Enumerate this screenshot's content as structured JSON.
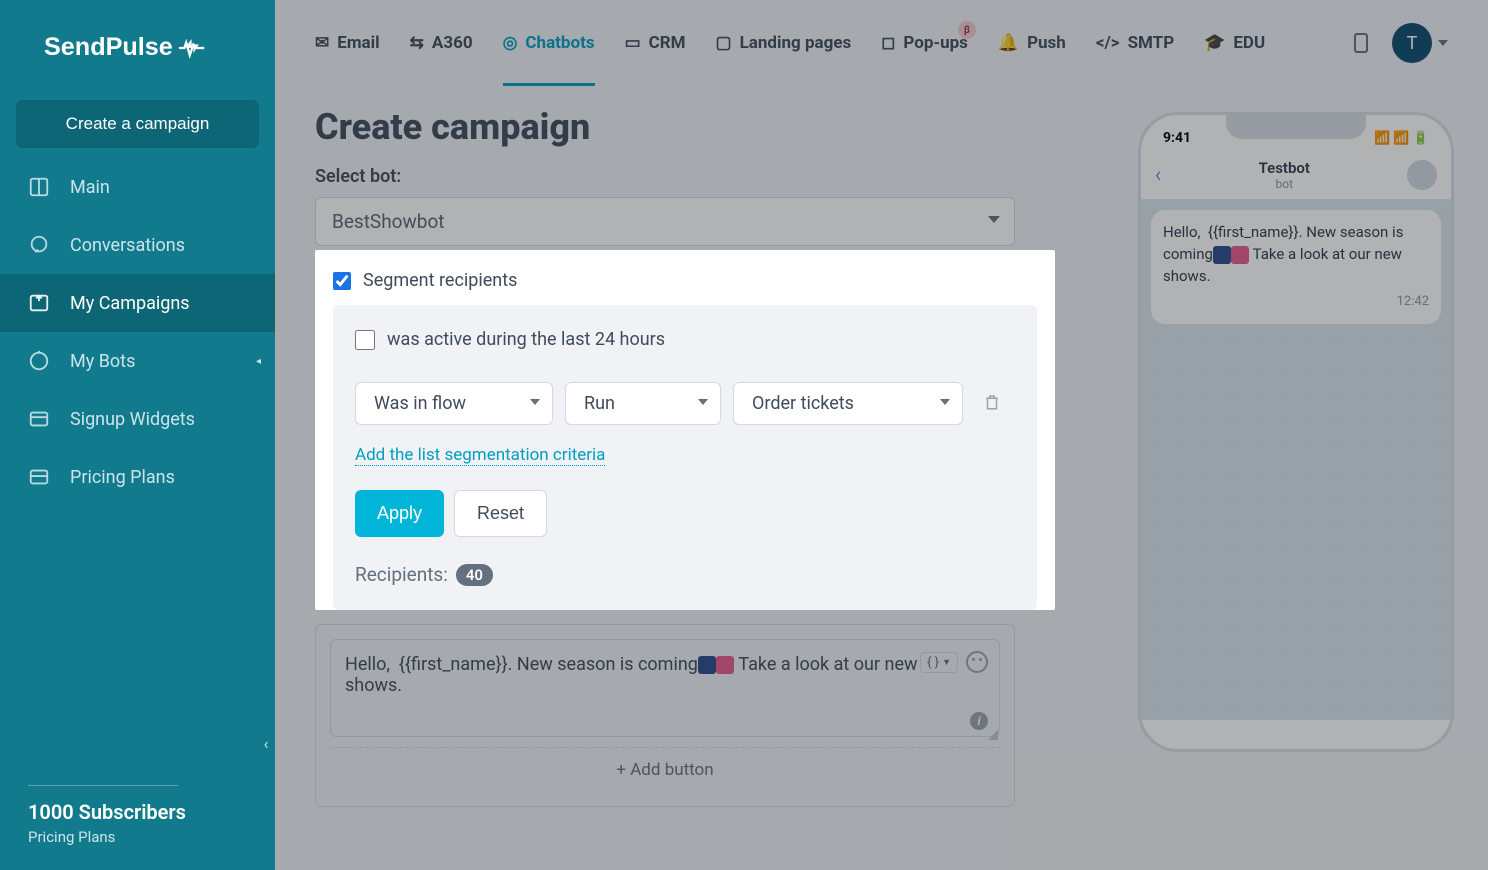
{
  "brand": "SendPulse",
  "sidebar": {
    "create_button": "Create a campaign",
    "items": [
      {
        "label": "Main",
        "icon": "columns"
      },
      {
        "label": "Conversations",
        "icon": "chat"
      },
      {
        "label": "My Campaigns",
        "icon": "campaign",
        "active": true
      },
      {
        "label": "My Bots",
        "icon": "bot",
        "has_arrow": true
      },
      {
        "label": "Signup Widgets",
        "icon": "widget"
      },
      {
        "label": "Pricing Plans",
        "icon": "pricing"
      }
    ],
    "subscribers": "1000 Subscribers",
    "subscribers_sub": "Pricing Plans"
  },
  "topnav": {
    "items": [
      {
        "label": "Email",
        "icon": "mail"
      },
      {
        "label": "A360",
        "icon": "a360"
      },
      {
        "label": "Chatbots",
        "icon": "chatbot",
        "active": true
      },
      {
        "label": "CRM",
        "icon": "crm"
      },
      {
        "label": "Landing pages",
        "icon": "landing"
      },
      {
        "label": "Pop-ups",
        "icon": "popup",
        "beta": "β"
      },
      {
        "label": "Push",
        "icon": "push"
      },
      {
        "label": "SMTP",
        "icon": "smtp"
      },
      {
        "label": "EDU",
        "icon": "edu"
      }
    ],
    "avatar_letter": "T"
  },
  "page": {
    "title": "Create campaign",
    "select_bot_label": "Select bot:",
    "selected_bot": "BestShowbot",
    "segment_checkbox": "Segment recipients",
    "active_checkbox": "was active during the last 24 hours",
    "filters": {
      "field": "Was in flow",
      "operator": "Run",
      "value": "Order tickets"
    },
    "add_criteria": "Add the list segmentation criteria",
    "apply": "Apply",
    "reset": "Reset",
    "recipients_label": "Recipients:",
    "recipients_count": "40",
    "message_text": "Hello,  {{first_name}}. New season is coming🎭🎪 Take a look at our new shows.",
    "add_button": "+ Add button"
  },
  "phone": {
    "time": "9:41",
    "bot_name": "Testbot",
    "bot_sub": "bot",
    "bubble_text": "Hello,  {{first_name}}. New season is coming🎭🎪 Take a look at our new shows.",
    "bubble_time": "12:42"
  }
}
